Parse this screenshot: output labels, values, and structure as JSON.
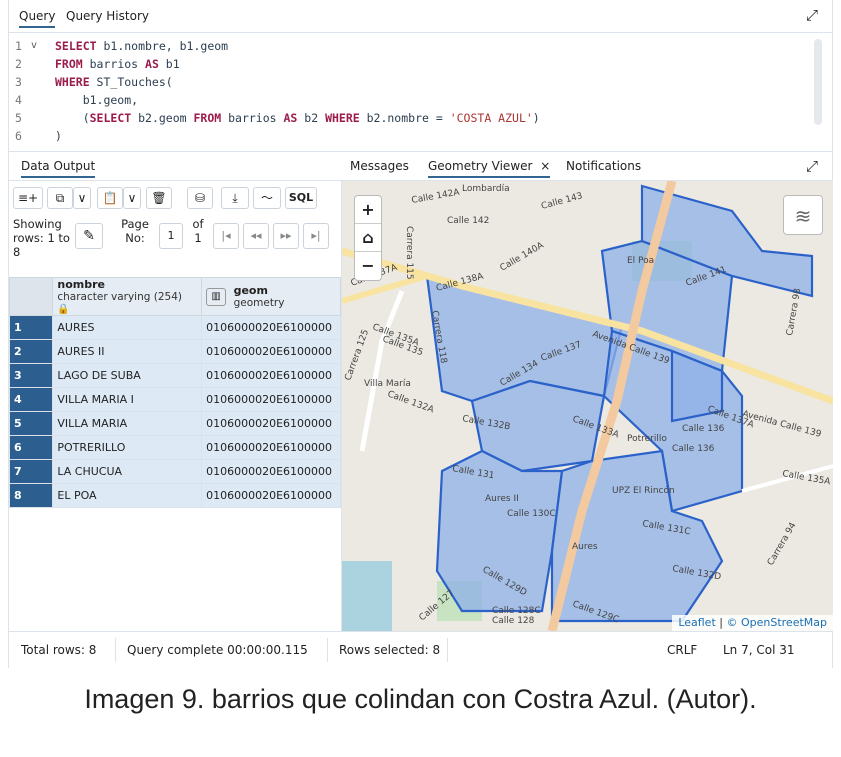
{
  "query_tabs": [
    "Query",
    "Query History"
  ],
  "editor": {
    "lines": [
      {
        "n": "1",
        "fold": "v",
        "parts": [
          {
            "k": "kw",
            "t": "SELECT"
          },
          {
            "k": "",
            "t": " b1.nombre, b1.geom"
          }
        ]
      },
      {
        "n": "2",
        "fold": "",
        "parts": [
          {
            "k": "kw",
            "t": "FROM"
          },
          {
            "k": "",
            "t": " barrios "
          },
          {
            "k": "kw",
            "t": "AS"
          },
          {
            "k": "",
            "t": " b1"
          }
        ]
      },
      {
        "n": "3",
        "fold": "",
        "parts": [
          {
            "k": "kw",
            "t": "WHERE"
          },
          {
            "k": "",
            "t": " ST_Touches("
          }
        ]
      },
      {
        "n": "4",
        "fold": "",
        "parts": [
          {
            "k": "",
            "t": "    b1.geom,"
          }
        ]
      },
      {
        "n": "5",
        "fold": "",
        "parts": [
          {
            "k": "",
            "t": "    ("
          },
          {
            "k": "kw",
            "t": "SELECT"
          },
          {
            "k": "",
            "t": " b2.geom "
          },
          {
            "k": "kw",
            "t": "FROM"
          },
          {
            "k": "",
            "t": " barrios "
          },
          {
            "k": "kw",
            "t": "AS"
          },
          {
            "k": "",
            "t": " b2 "
          },
          {
            "k": "kw",
            "t": "WHERE"
          },
          {
            "k": "",
            "t": " b2.nombre = "
          },
          {
            "k": "str",
            "t": "'COSTA AZUL'"
          },
          {
            "k": "",
            "t": ")"
          }
        ]
      },
      {
        "n": "6",
        "fold": "",
        "parts": [
          {
            "k": "",
            "t": ")"
          }
        ]
      }
    ]
  },
  "result_tabs": {
    "data_output": "Data Output",
    "messages": "Messages",
    "geometry_viewer": "Geometry Viewer",
    "geometry_close": "×",
    "notifications": "Notifications"
  },
  "toolbar": {
    "add_row": "≡+",
    "copy": "⧉",
    "dropdown1": "∨",
    "paste": "📋",
    "dropdown2": "∨",
    "delete": "🗑",
    "save": "⛁",
    "download": "⤓",
    "graph": "〜",
    "sql": "SQL"
  },
  "pager": {
    "showing_label": "Showing rows: 1 to 8",
    "edit_icon": "✎",
    "page_label": "Page No:",
    "page_value": "1",
    "of_label": "of",
    "of_value": "1",
    "first": "|◂",
    "prev": "◂◂",
    "next": "▸▸",
    "last": "▸|"
  },
  "grid": {
    "columns": [
      {
        "name": "nombre",
        "type": "character varying (254)",
        "lock_icon": "🔒"
      },
      {
        "name": "geom",
        "type": "geometry",
        "map_icon": "📖"
      }
    ],
    "rows": [
      {
        "n": "1",
        "nombre": "AURES",
        "geom": "0106000020E6100000"
      },
      {
        "n": "2",
        "nombre": "AURES II",
        "geom": "0106000020E6100000"
      },
      {
        "n": "3",
        "nombre": "LAGO DE SUBA",
        "geom": "0106000020E6100000"
      },
      {
        "n": "4",
        "nombre": "VILLA MARIA I",
        "geom": "0106000020E6100000"
      },
      {
        "n": "5",
        "nombre": "VILLA MARIA",
        "geom": "0106000020E6100000"
      },
      {
        "n": "6",
        "nombre": "POTRERILLO",
        "geom": "0106000020E6100000"
      },
      {
        "n": "7",
        "nombre": "LA CHUCUA",
        "geom": "0106000020E6100000"
      },
      {
        "n": "8",
        "nombre": "EL POA",
        "geom": "0106000020E6100000"
      }
    ]
  },
  "map": {
    "zoom_in": "+",
    "home": "⌂",
    "zoom_out": "−",
    "layers_icon": "≋",
    "labels": [
      "Lombardía",
      "Calle 142A",
      "Calle 142",
      "Calle 143",
      "Carrera 115",
      "Calle 137A",
      "Calle 138A",
      "Carrera 118",
      "Calle 135A",
      "Calle 135",
      "Carrera 125",
      "Villa María",
      "Calle 132A",
      "Calle 140A",
      "Calle 141",
      "El Poa",
      "Calle 137",
      "Avenida Calle 139",
      "Calle 134",
      "Calle 133A",
      "Calle 132B",
      "Potrerillo",
      "Calle 136",
      "Calle 137A",
      "Avenida Calle 139",
      "Calle 131",
      "Aures II",
      "Calle 130C",
      "UPZ El Rincón",
      "Calle 131C",
      "Aures",
      "Calle 129D",
      "Calle 129C",
      "Calle 128C",
      "Calle 128",
      "Calle 127",
      "Calle 132D",
      "Carrera 94",
      "Calle 135A",
      "Calle 136",
      "Carrera 98"
    ],
    "attribution_leaflet": "Leaflet",
    "attribution_sep": "|",
    "attribution_osm": "© OpenStreetMap",
    "colors": {
      "polygon_fill": "#8fb0e8",
      "polygon_stroke": "#2b62c9",
      "road_main": "#f3c9a0",
      "road_arterial": "#f8e3a0",
      "land": "#ece9e2",
      "park": "#c8e3c1"
    }
  },
  "status": {
    "total_rows": "Total rows: 8",
    "query_complete": "Query complete 00:00:00.115",
    "rows_selected": "Rows selected: 8",
    "crlf": "CRLF",
    "position": "Ln 7, Col 31"
  },
  "caption": "Imagen 9. barrios que colindan con Costra Azul. (Autor)."
}
